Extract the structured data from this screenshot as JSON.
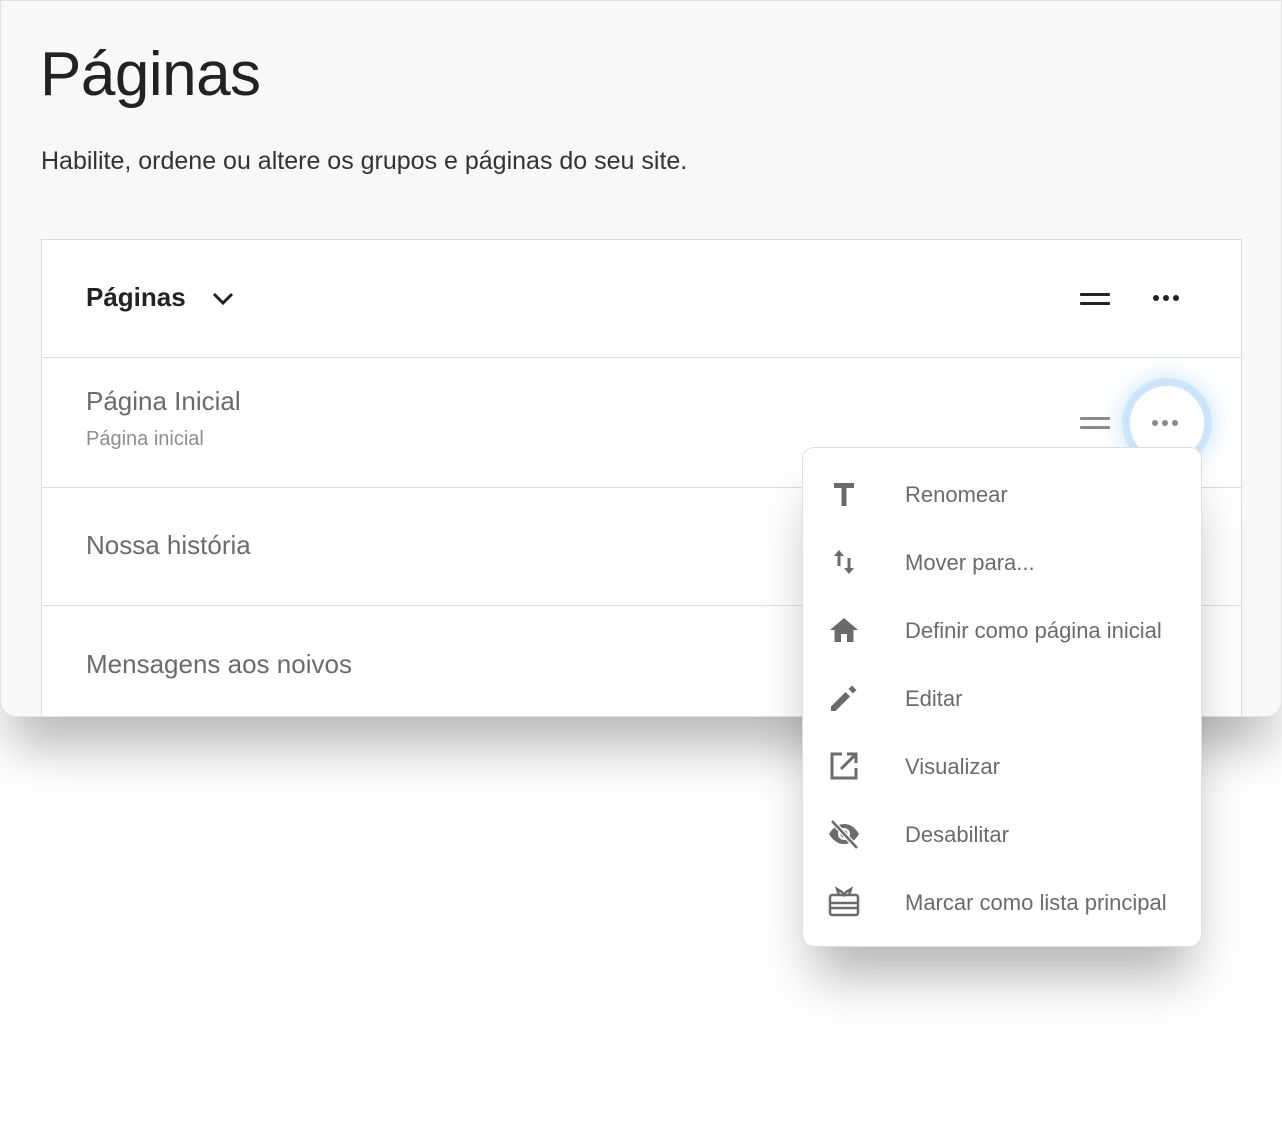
{
  "header": {
    "title": "Páginas",
    "subtitle": "Habilite, ordene ou altere os grupos e páginas do seu site."
  },
  "group": {
    "title": "Páginas"
  },
  "rows": [
    {
      "title": "Página Inicial",
      "subtitle": "Página inicial"
    },
    {
      "title": "Nossa história"
    },
    {
      "title": "Mensagens aos noivos"
    }
  ],
  "menu": {
    "items": [
      {
        "label": "Renomear",
        "icon": "text-icon"
      },
      {
        "label": "Mover para...",
        "icon": "move-icon"
      },
      {
        "label": "Definir como página inicial",
        "icon": "home-icon"
      },
      {
        "label": "Editar",
        "icon": "pencil-icon"
      },
      {
        "label": "Visualizar",
        "icon": "open-external-icon"
      },
      {
        "label": "Desabilitar",
        "icon": "eye-off-icon"
      },
      {
        "label": "Marcar como lista principal",
        "icon": "gift-card-icon"
      }
    ]
  },
  "colors": {
    "panel_bg": "#f8f8f8",
    "text_dark": "#222222",
    "text_muted": "#6b6b6b",
    "focus_glow": "#aad2f5"
  }
}
